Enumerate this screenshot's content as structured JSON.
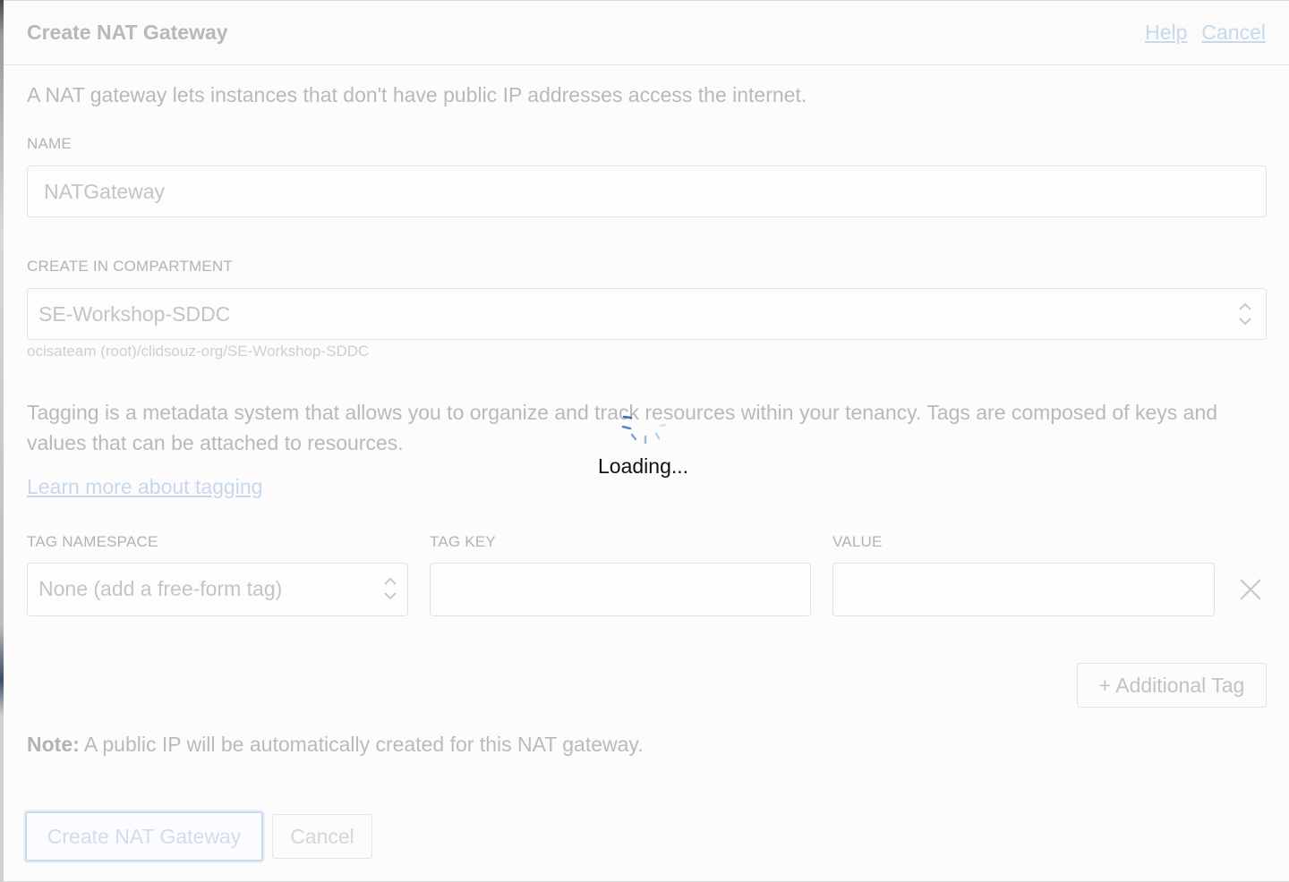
{
  "header": {
    "title": "Create NAT Gateway",
    "help_link": "Help",
    "cancel_link": "Cancel"
  },
  "intro": "A NAT gateway lets instances that don't have public IP addresses access the internet.",
  "name_field": {
    "label": "NAME",
    "value": "NATGateway"
  },
  "compartment_field": {
    "label": "CREATE IN COMPARTMENT",
    "selected": "SE-Workshop-SDDC",
    "path": "ocisateam (root)/clidsouz-org/SE-Workshop-SDDC"
  },
  "tagging": {
    "description": "Tagging is a metadata system that allows you to organize and track resources within your tenancy. Tags are composed of keys and values that can be attached to resources.",
    "learn_more_link": "Learn more about tagging",
    "namespace_label": "TAG NAMESPACE",
    "namespace_selected": "None (add a free-form tag)",
    "key_label": "TAG KEY",
    "key_value": "",
    "value_label": "VALUE",
    "value_value": "",
    "remove_icon": "close-icon",
    "add_button": "+ Additional Tag"
  },
  "note": {
    "strong": "Note:",
    "text": " A public IP will be automatically created for this NAT gateway."
  },
  "footer": {
    "create_button": "Create NAT Gateway",
    "cancel_button": "Cancel"
  },
  "overlay": {
    "loading_text": "Loading...",
    "spinner_icon": "spinner-icon",
    "spinner_color": "#3f6fb0"
  }
}
